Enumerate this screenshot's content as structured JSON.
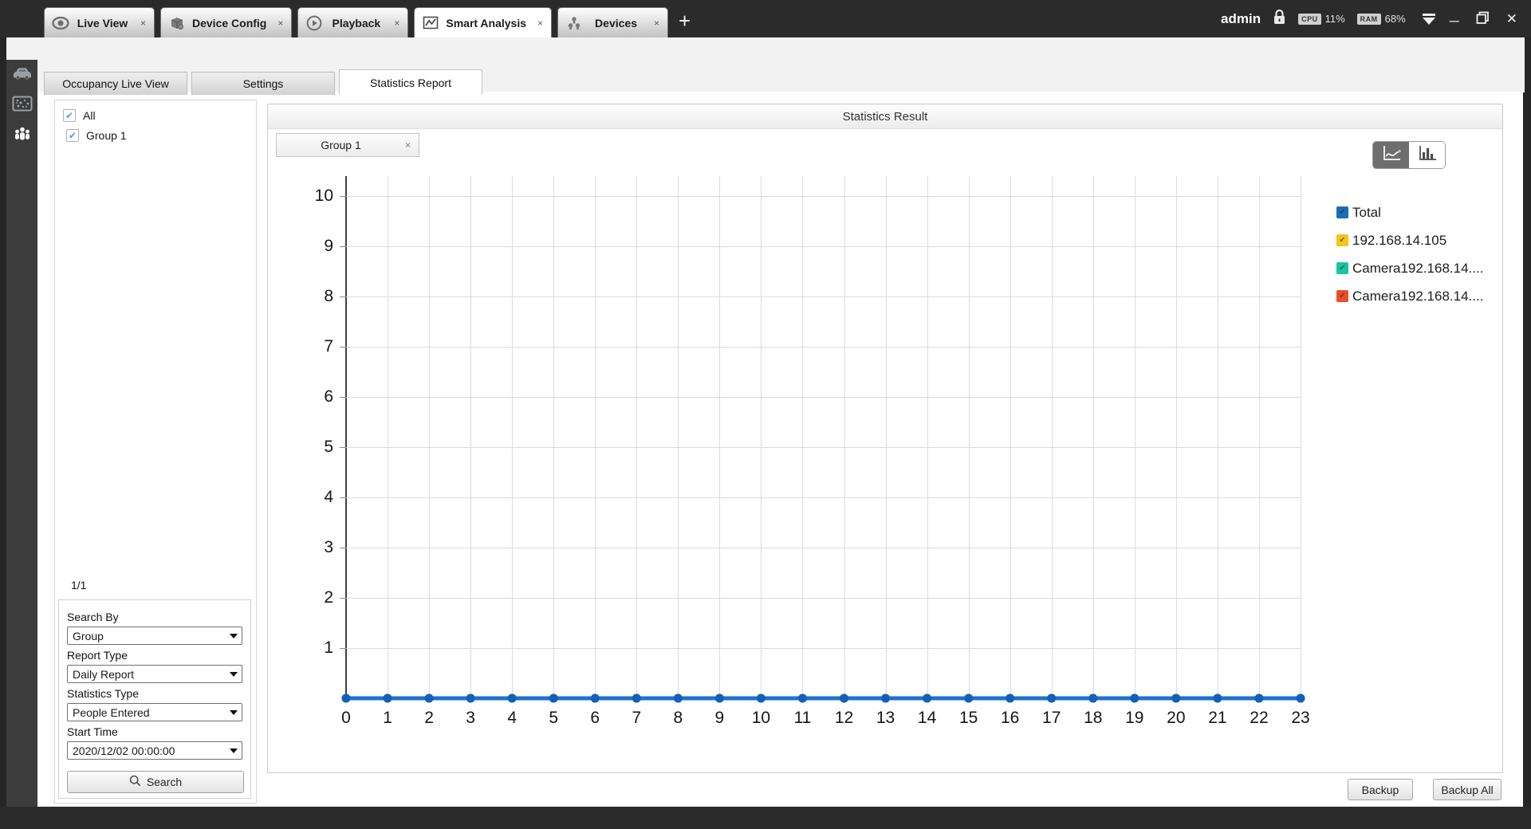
{
  "window": {
    "user": "admin",
    "cpu_label": "CPU",
    "cpu_value": "11%",
    "ram_label": "RAM",
    "ram_value": "68%",
    "new_tab_glyph": "+",
    "close_glyph": "✕",
    "minimize_glyph": "─"
  },
  "icons": {
    "tab_close_glyph": "×",
    "check_glyph": "✔"
  },
  "tabs": [
    {
      "label": "Live View"
    },
    {
      "label": "Device Config"
    },
    {
      "label": "Playback"
    },
    {
      "label": "Smart Analysis"
    },
    {
      "label": "Devices"
    }
  ],
  "subtabs": [
    {
      "label": "Occupancy Live View"
    },
    {
      "label": "Settings"
    },
    {
      "label": "Statistics Report"
    }
  ],
  "tree": {
    "items": [
      {
        "label": "All",
        "checked": true
      },
      {
        "label": "Group 1",
        "checked": true
      }
    ],
    "pagination": "1/1"
  },
  "search_form": {
    "search_by_label": "Search By",
    "search_by_value": "Group",
    "report_type_label": "Report Type",
    "report_type_value": "Daily Report",
    "statistics_type_label": "Statistics Type",
    "statistics_type_value": "People Entered",
    "start_time_label": "Start Time",
    "start_time_value": "2020/12/02 00:00:00",
    "search_button_label": "Search"
  },
  "result_panel": {
    "title": "Statistics Result",
    "group_tab_label": "Group 1",
    "backup_label": "Backup",
    "backup_all_label": "Backup All",
    "legend": [
      {
        "label": "Total",
        "color": "#1a6eb4"
      },
      {
        "label": "192.168.14.105",
        "color": "#f5c51d"
      },
      {
        "label": "Camera192.168.14....",
        "color": "#17c5a3"
      },
      {
        "label": "Camera192.168.14....",
        "color": "#e8502b"
      }
    ]
  },
  "chart_data": {
    "type": "line",
    "title": "Statistics Result",
    "xlabel": "",
    "ylabel": "",
    "x": [
      0,
      1,
      2,
      3,
      4,
      5,
      6,
      7,
      8,
      9,
      10,
      11,
      12,
      13,
      14,
      15,
      16,
      17,
      18,
      19,
      20,
      21,
      22,
      23
    ],
    "yticks": [
      1,
      2,
      3,
      4,
      5,
      6,
      7,
      8,
      9,
      10
    ],
    "ylim": [
      0,
      10
    ],
    "xlim": [
      0,
      23
    ],
    "grid": true,
    "legend_position": "right",
    "series": [
      {
        "name": "Total",
        "color": "#1a73cf",
        "marker_color": "#1161b8",
        "values": [
          0,
          0,
          0,
          0,
          0,
          0,
          0,
          0,
          0,
          0,
          0,
          0,
          0,
          0,
          0,
          0,
          0,
          0,
          0,
          0,
          0,
          0,
          0,
          0
        ]
      },
      {
        "name": "192.168.14.105",
        "color": "#f5c51d",
        "values": [
          0,
          0,
          0,
          0,
          0,
          0,
          0,
          0,
          0,
          0,
          0,
          0,
          0,
          0,
          0,
          0,
          0,
          0,
          0,
          0,
          0,
          0,
          0,
          0
        ]
      },
      {
        "name": "Camera192.168.14....",
        "color": "#17c5a3",
        "values": [
          0,
          0,
          0,
          0,
          0,
          0,
          0,
          0,
          0,
          0,
          0,
          0,
          0,
          0,
          0,
          0,
          0,
          0,
          0,
          0,
          0,
          0,
          0,
          0
        ]
      },
      {
        "name": "Camera192.168.14....",
        "color": "#e8502b",
        "values": [
          0,
          0,
          0,
          0,
          0,
          0,
          0,
          0,
          0,
          0,
          0,
          0,
          0,
          0,
          0,
          0,
          0,
          0,
          0,
          0,
          0,
          0,
          0,
          0
        ]
      }
    ]
  }
}
